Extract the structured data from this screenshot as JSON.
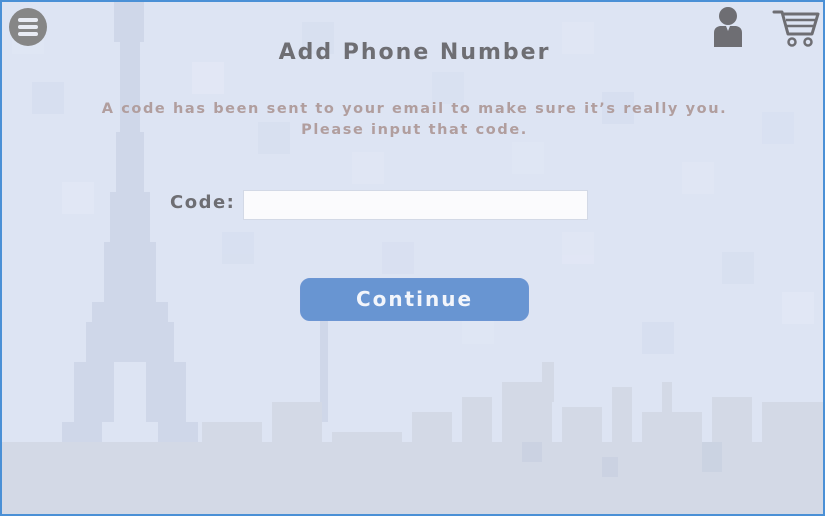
{
  "header": {
    "menu_icon": "hamburger-menu-icon",
    "profile_icon": "user-profile-icon",
    "cart_icon": "shopping-cart-icon"
  },
  "page": {
    "title": "Add Phone Number",
    "message_line1": "A code has been sent to your email to make sure it’s really you.",
    "message_line2": "Please input that code."
  },
  "form": {
    "code_label": "Code:",
    "code_value": "",
    "continue_label": "Continue"
  },
  "colors": {
    "background": "#dde4f3",
    "text_dark": "#6e6e73",
    "text_muted": "#b19e9e",
    "button_primary": "#6895d2",
    "icon_gray": "#868686",
    "frame_border": "#4a90d6"
  }
}
